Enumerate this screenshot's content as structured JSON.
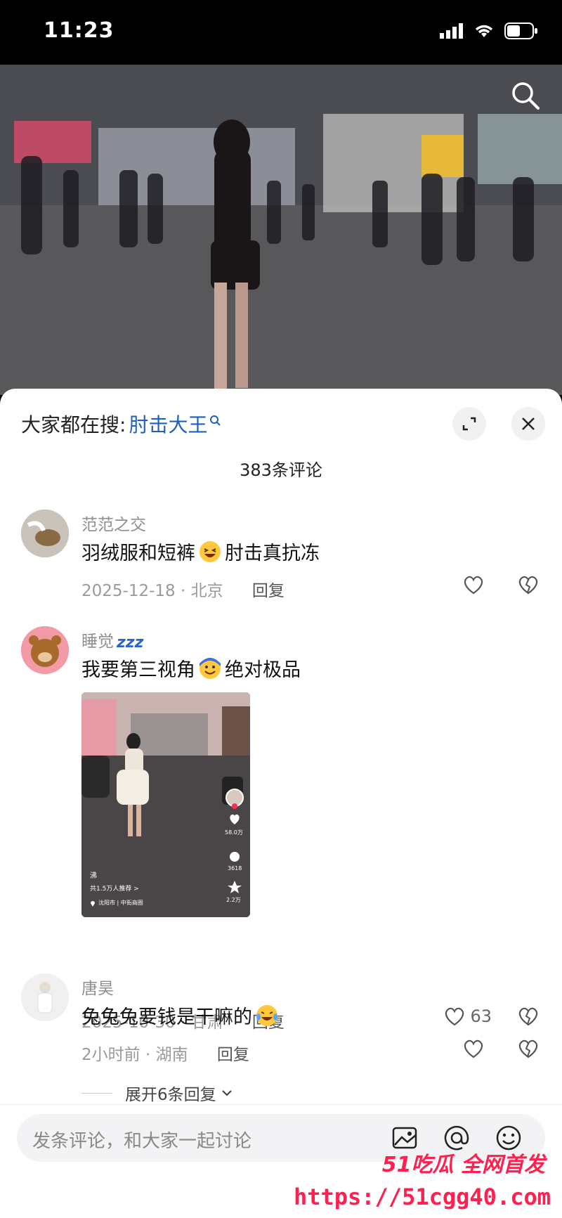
{
  "status": {
    "time": "11:23"
  },
  "sheet": {
    "hot_search_prefix": "大家都在搜:",
    "hot_search_term": "肘击大王",
    "comment_count": "383条评论"
  },
  "comments": [
    {
      "name": "范范之交",
      "text_before": "羽绒服和短裤",
      "emoji": "laughing-emoji",
      "text_after": "肘击真抗冻",
      "date_loc": "2025-12-18 · 北京",
      "reply": "回复",
      "likes": ""
    },
    {
      "name": "睡觉",
      "name_badge": "zzz",
      "text_before": "我要第三视角",
      "emoji": "grinning-emoji",
      "text_after": "绝对极品",
      "date_loc": "2025-10-30 · 甘肃",
      "reply": "回复",
      "likes": "63",
      "thumbnail": {
        "likes": "58.0万",
        "comments": "3618",
        "stars": "2.2万",
        "recommend": "共1.5万人推荐 >",
        "location": "沈阳市 | 中街商圈",
        "caption": "沸"
      }
    },
    {
      "name": "唐昊",
      "text_before": "兔兔兔要钱是干嘛的",
      "emoji": "crying-laughing-emoji",
      "text_after": "",
      "date_loc": "2小时前 · 湖南",
      "reply": "回复",
      "likes": ""
    }
  ],
  "expand_replies": "展开6条回复",
  "input": {
    "placeholder": "发条评论，和大家一起讨论"
  },
  "watermark": {
    "brand": "51吃瓜 全网首发",
    "url": "https://51cgg40.com"
  }
}
